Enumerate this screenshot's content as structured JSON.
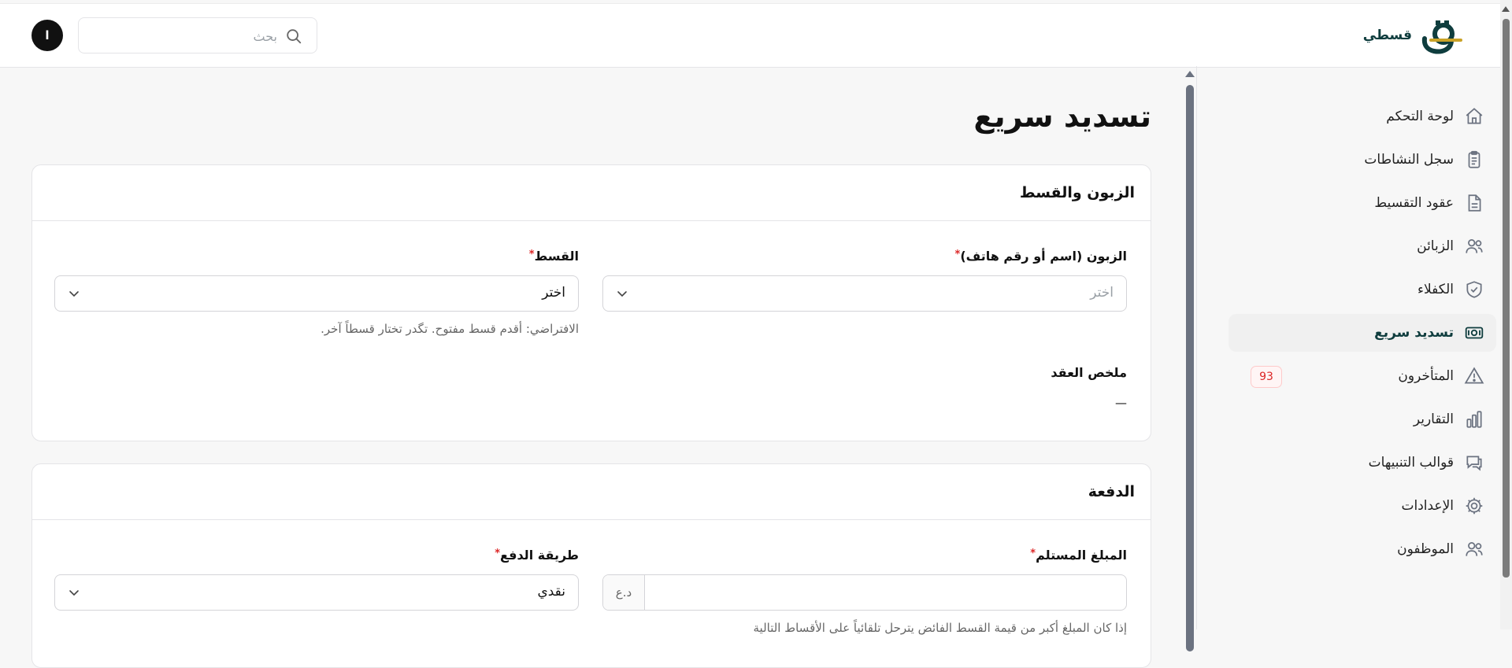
{
  "header": {
    "brand_name": "قسطي",
    "search_placeholder": "بحث",
    "avatar_initial": "ا"
  },
  "sidebar": {
    "items": [
      {
        "label": "لوحة التحكم",
        "icon": "home-icon"
      },
      {
        "label": "سجل النشاطات",
        "icon": "clipboard-icon"
      },
      {
        "label": "عقود التقسيط",
        "icon": "document-icon"
      },
      {
        "label": "الزبائن",
        "icon": "users-icon"
      },
      {
        "label": "الكفلاء",
        "icon": "shield-check-icon"
      },
      {
        "label": "تسديد سريع",
        "icon": "cash-icon",
        "active": true
      },
      {
        "label": "المتأخرون",
        "icon": "warning-icon",
        "badge": "93"
      },
      {
        "label": "التقارير",
        "icon": "bar-chart-icon"
      },
      {
        "label": "قوالب التنبيهات",
        "icon": "chat-icon"
      },
      {
        "label": "الإعدادات",
        "icon": "gear-icon"
      },
      {
        "label": "الموظفون",
        "icon": "team-icon"
      }
    ]
  },
  "main": {
    "title": "تسديد سريع",
    "customer_card": {
      "title": "الزبون والقسط",
      "customer_label": "الزبون (اسم أو رقم هاتف)",
      "customer_placeholder": "اختر",
      "installment_label": "القسط",
      "installment_value": "اختر",
      "installment_hint": "الافتراضي: أقدم قسط مفتوح. تگدر تختار قسطاً آخر.",
      "summary_label": "ملخص العقد",
      "summary_value": "—"
    },
    "payment_card": {
      "title": "الدفعة",
      "amount_label": "المبلغ المستلم",
      "amount_value": "",
      "currency": "د.ع",
      "method_label": "طريقة الدفع",
      "method_value": "نقدي",
      "amount_hint": "إذا كان المبلغ أكبر من قيمة القسط الفائض يترحل تلقائياً على الأقساط التالية"
    },
    "required_mark": "*"
  },
  "colors": {
    "brand": "#0f3d3e",
    "accent_gold": "#c9a227",
    "required": "#dc2626",
    "badge": "#dc2626"
  }
}
